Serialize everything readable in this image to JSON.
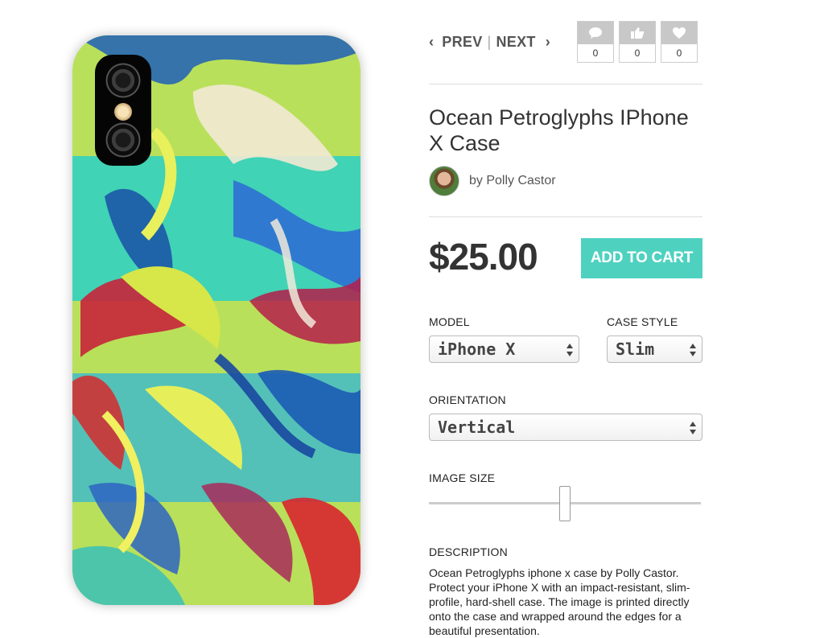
{
  "nav": {
    "prev": "PREV",
    "separator": "|",
    "next": "NEXT"
  },
  "social": [
    {
      "icon": "comment-icon",
      "count": "0"
    },
    {
      "icon": "thumbs-up-icon",
      "count": "0"
    },
    {
      "icon": "heart-icon",
      "count": "0"
    }
  ],
  "product": {
    "title": "Ocean Petroglyphs IPhone X Case",
    "artist": "by Polly Castor",
    "price": "$25.00",
    "add_to_cart": "ADD TO CART"
  },
  "options": {
    "model_label": "MODEL",
    "model_value": "iPhone X",
    "case_style_label": "CASE STYLE",
    "case_style_value": "Slim",
    "orientation_label": "ORIENTATION",
    "orientation_value": "Vertical",
    "image_size_label": "IMAGE SIZE",
    "image_size_level": 0.5
  },
  "description": {
    "label": "DESCRIPTION",
    "text": "Ocean Petroglyphs iphone x case by Polly Castor.   Protect your iPhone X with an impact-resistant, slim-profile, hard-shell case. The image is printed directly onto the case and wrapped around the edges for a beautiful presentation."
  },
  "colors": {
    "accent": "#4fd1c0",
    "social_box": "#c8c8c8"
  }
}
